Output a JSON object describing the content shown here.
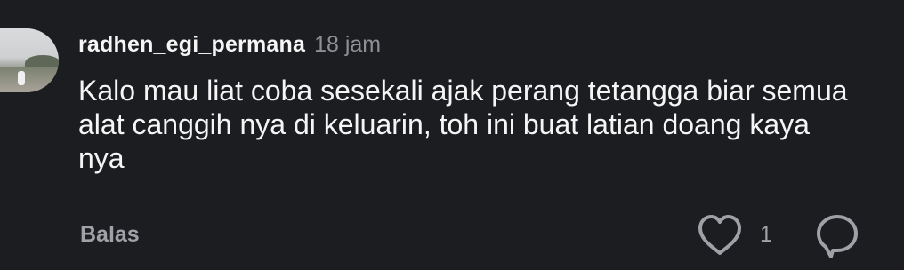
{
  "comment": {
    "username": "radhen_egi_permana",
    "time": "18 jam",
    "text": "Kalo mau liat coba sesekali ajak perang tetangga biar semua alat canggih nya di keluarin, toh ini buat latian doang kaya nya",
    "reply_label": "Balas",
    "like_count": "1"
  },
  "icons": {
    "like": "heart-icon",
    "reply": "speech-bubble-icon"
  },
  "colors": {
    "background": "#1c1d21",
    "primary_text": "#f5f5f5",
    "secondary_text": "#8e8f94",
    "icon": "#a0a1a6"
  }
}
